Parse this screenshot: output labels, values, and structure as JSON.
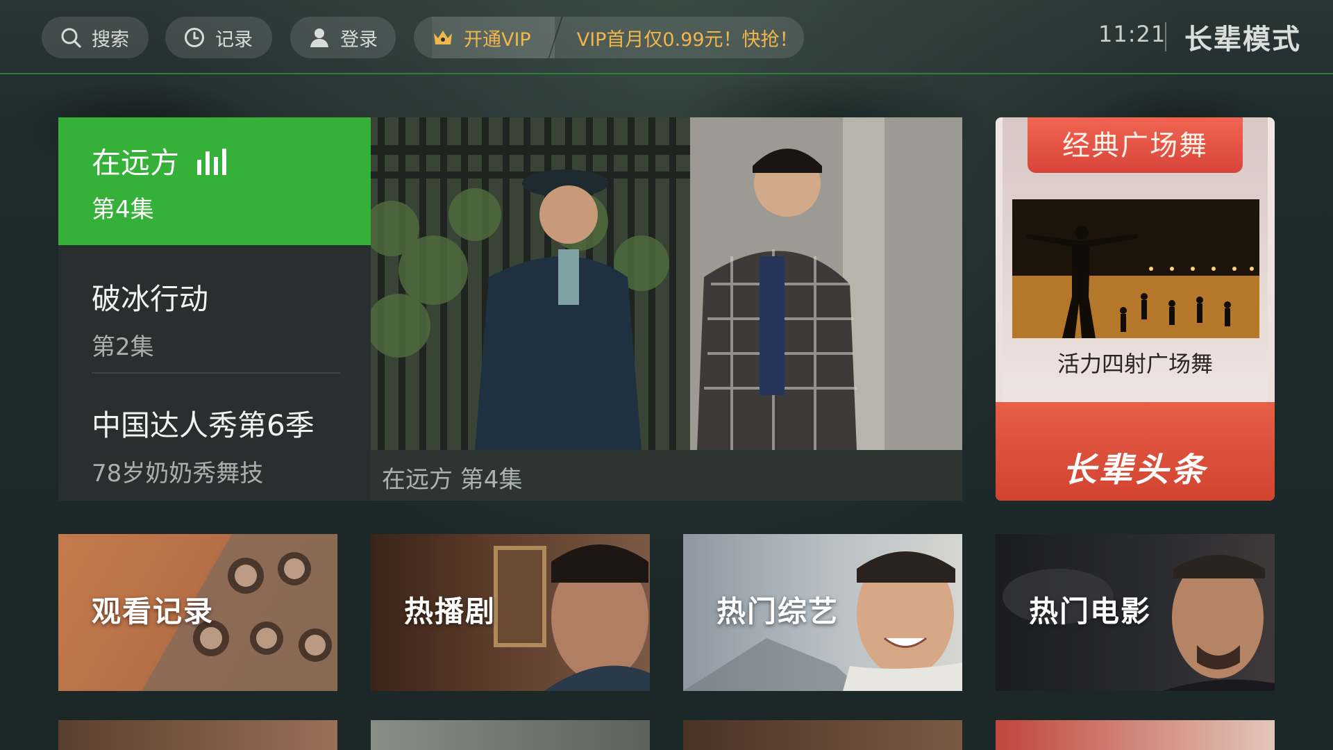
{
  "topbar": {
    "search_label": "搜索",
    "history_label": "记录",
    "login_label": "登录",
    "vip_label": "开通VIP",
    "vip_promo": "VIP首月仅0.99元！快抢！",
    "clock": "11:21",
    "mode_label": "长辈模式"
  },
  "playlist": {
    "items": [
      {
        "title": "在远方",
        "subtitle": "第4集",
        "playing": true
      },
      {
        "title": "破冰行动",
        "subtitle": "第2集",
        "playing": false
      },
      {
        "title": "中国达人秀第6季",
        "subtitle": "78岁奶奶秀舞技",
        "playing": false
      }
    ]
  },
  "player": {
    "caption": "在远方  第4集"
  },
  "promo": {
    "tag": "经典广场舞",
    "subtitle": "活力四射广场舞",
    "brand": "长辈头条"
  },
  "tiles": [
    {
      "label": "观看记录"
    },
    {
      "label": "热播剧"
    },
    {
      "label": "热门综艺"
    },
    {
      "label": "热门电影"
    }
  ],
  "colors": {
    "accent_green": "#35b13a",
    "vip_gold": "#f2b64a",
    "promo_red": "#d9443a"
  }
}
